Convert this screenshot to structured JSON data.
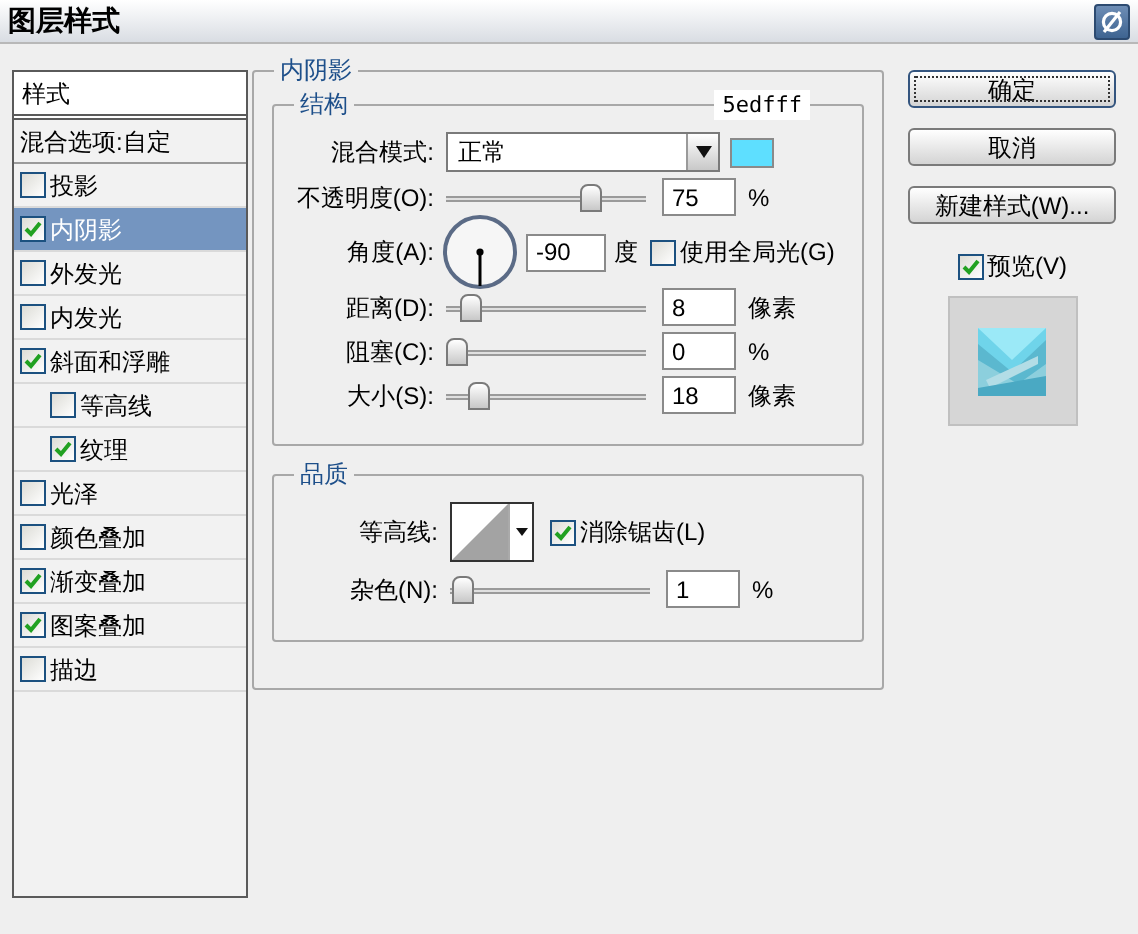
{
  "window": {
    "title": "图层样式"
  },
  "sidebar": {
    "header": "样式",
    "blend_options": "混合选项:自定",
    "items": [
      {
        "label": "投影",
        "checked": false,
        "selected": false
      },
      {
        "label": "内阴影",
        "checked": true,
        "selected": true
      },
      {
        "label": "外发光",
        "checked": false,
        "selected": false
      },
      {
        "label": "内发光",
        "checked": false,
        "selected": false
      },
      {
        "label": "斜面和浮雕",
        "checked": true,
        "selected": false,
        "children": [
          {
            "label": "等高线",
            "checked": false,
            "selected": false
          },
          {
            "label": "纹理",
            "checked": true,
            "selected": false
          }
        ]
      },
      {
        "label": "光泽",
        "checked": false,
        "selected": false
      },
      {
        "label": "颜色叠加",
        "checked": false,
        "selected": false
      },
      {
        "label": "渐变叠加",
        "checked": true,
        "selected": false
      },
      {
        "label": "图案叠加",
        "checked": true,
        "selected": false
      },
      {
        "label": "描边",
        "checked": false,
        "selected": false
      }
    ]
  },
  "panel": {
    "title": "内阴影",
    "structure": {
      "title": "结构",
      "color_hex": "5edfff",
      "rows": [
        {
          "kind": "blend",
          "label": "混合模式:",
          "value": "正常",
          "color": "#5edfff"
        },
        {
          "kind": "slider",
          "label": "不透明度(O):",
          "level": 0.75,
          "value": "75",
          "unit": "%"
        },
        {
          "kind": "angle",
          "label": "角度(A):",
          "value": "-90",
          "unit": "度",
          "option": {
            "label": "使用全局光(G)",
            "checked": false
          }
        },
        {
          "kind": "slider",
          "label": "距离(D):",
          "level": 0.08,
          "value": "8",
          "unit": "像素"
        },
        {
          "kind": "slider",
          "label": "阻塞(C):",
          "level": 0,
          "value": "0",
          "unit": "%"
        },
        {
          "kind": "slider",
          "label": "大小(S):",
          "level": 0.12,
          "value": "18",
          "unit": "像素"
        }
      ]
    },
    "quality": {
      "title": "品质",
      "rows": [
        {
          "kind": "contour",
          "label": "等高线:",
          "option": {
            "label": "消除锯齿(L)",
            "checked": true
          }
        },
        {
          "kind": "slider",
          "label": "杂色(N):",
          "level": 0.01,
          "value": "1",
          "unit": "%"
        }
      ]
    }
  },
  "buttons": [
    {
      "label": "确定",
      "default": true
    },
    {
      "label": "取消",
      "default": false
    },
    {
      "label": "新建样式(W)...",
      "default": false
    }
  ],
  "preview": {
    "label": "预览(V)",
    "checked": true,
    "kind": "picture"
  }
}
